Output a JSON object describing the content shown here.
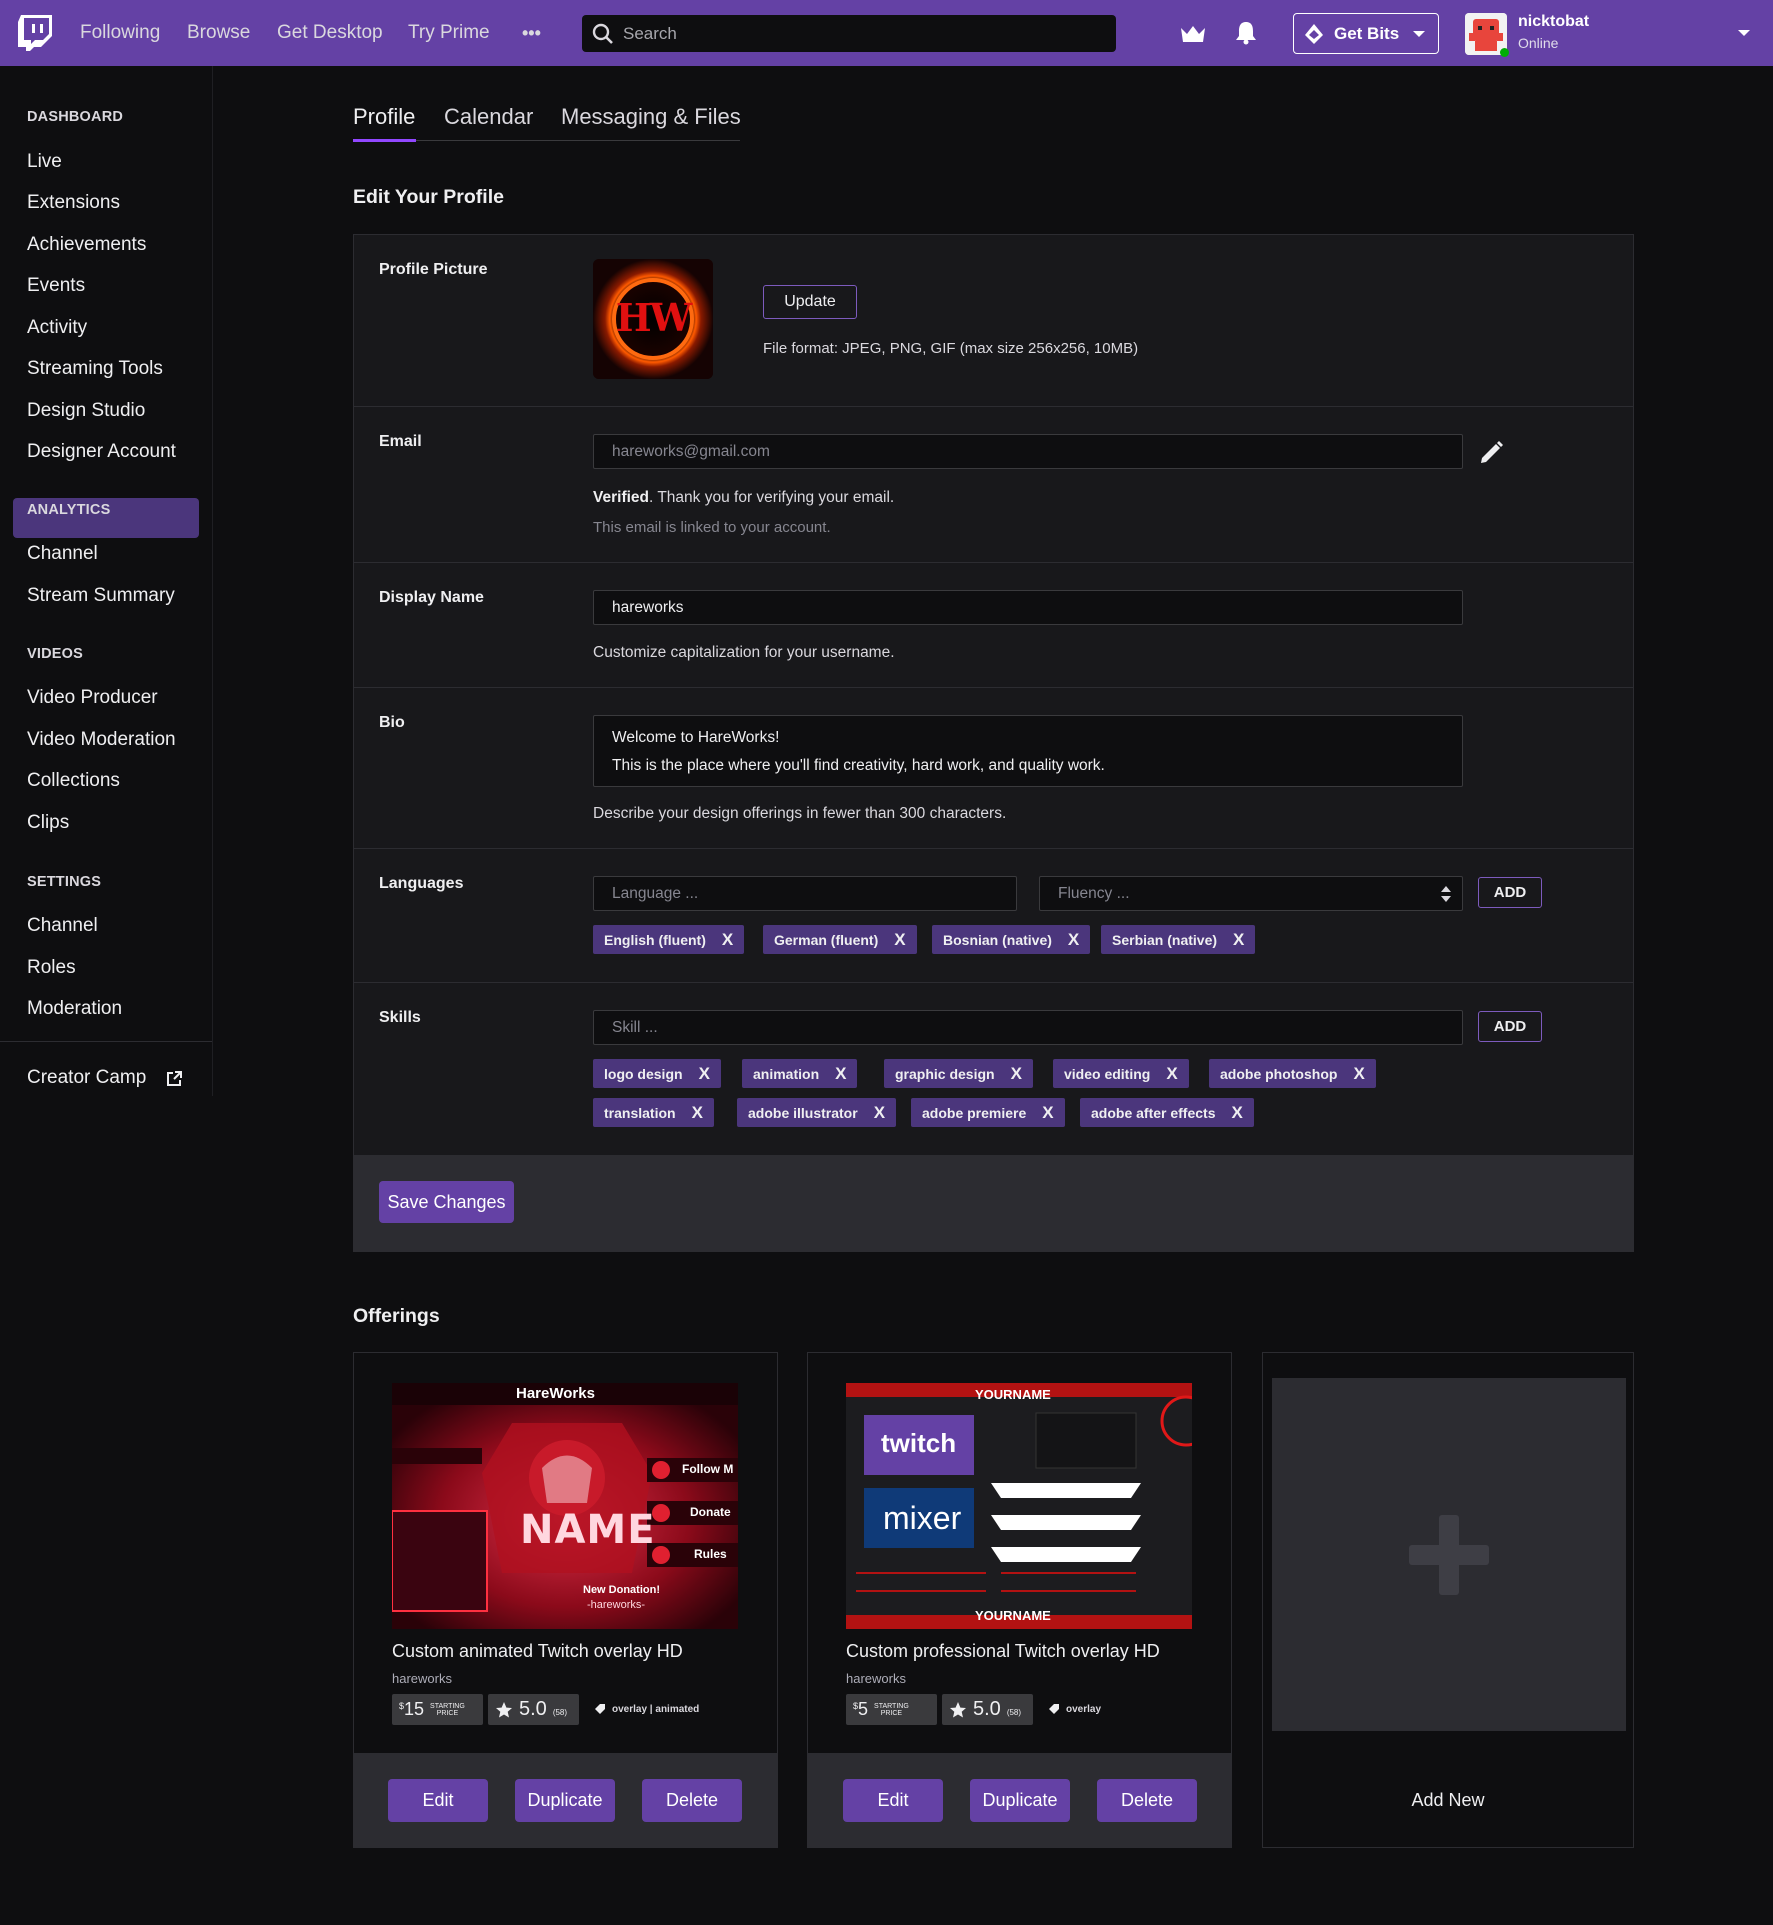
{
  "topbar": {
    "nav": [
      "Following",
      "Browse",
      "Get Desktop",
      "Try Prime"
    ],
    "more": "•••",
    "search_placeholder": "Search",
    "get_bits": "Get Bits",
    "user_name": "nicktobat",
    "user_status": "Online"
  },
  "sidebar": {
    "dashboard_head": "DASHBOARD",
    "dashboard_items": [
      "Live",
      "Extensions",
      "Achievements",
      "Events",
      "Activity",
      "Streaming Tools",
      "Design Studio",
      "Designer Account"
    ],
    "analytics_head": "ANALYTICS",
    "analytics_items": [
      "Channel",
      "Stream Summary"
    ],
    "videos_head": "VIDEOS",
    "videos_items": [
      "Video Producer",
      "Video Moderation",
      "Collections",
      "Clips"
    ],
    "settings_head": "SETTINGS",
    "settings_items": [
      "Channel",
      "Roles",
      "Moderation"
    ],
    "creator_camp": "Creator Camp"
  },
  "tabs": [
    "Profile",
    "Calendar",
    "Messaging & Files"
  ],
  "profile": {
    "heading": "Edit Your Profile",
    "picture_label": "Profile Picture",
    "picture_initials": "HW",
    "update_button": "Update",
    "file_format": "File format: JPEG, PNG, GIF (max size 256x256, 10MB)",
    "email_label": "Email",
    "email_value": "hareworks@gmail.com",
    "verified_bold": "Verified",
    "verified_text": ". Thank you for verifying your email.",
    "email_linked": "This email is linked to your account.",
    "display_label": "Display Name",
    "display_value": "hareworks",
    "display_hint": "Customize capitalization for your username.",
    "bio_label": "Bio",
    "bio_line1": "Welcome to HareWorks!",
    "bio_line2": "This is the place where you'll find creativity, hard work, and quality work.",
    "bio_hint": "Describe your design offerings in fewer than 300 characters.",
    "languages_label": "Languages",
    "language_placeholder": "Language ...",
    "fluency_placeholder": "Fluency ...",
    "add_label": "ADD",
    "languages": [
      "English (fluent)",
      "German (fluent)",
      "Bosnian (native)",
      "Serbian (native)"
    ],
    "skills_label": "Skills",
    "skill_placeholder": "Skill ...",
    "skills": [
      "logo design",
      "animation",
      "graphic design",
      "video editing",
      "adobe photoshop",
      "translation",
      "adobe illustrator",
      "adobe premiere",
      "adobe after effects"
    ],
    "remove_glyph": "X",
    "save_button": "Save Changes"
  },
  "offerings": {
    "heading": "Offerings",
    "items": [
      {
        "title": "Custom animated Twitch overlay HD",
        "author": "hareworks",
        "price_symbol": "$",
        "price": "15",
        "price_caption_1": "STARTING",
        "price_caption_2": "PRICE",
        "rating": "5.0",
        "reviews": "(58)",
        "tags": "overlay | animated",
        "thumb_brand": "HareWorks",
        "thumb_name": "NAME",
        "thumb_follow": "Follow M",
        "thumb_donate": "Donate",
        "thumb_rules": "Rules",
        "thumb_donation": "New Donation!",
        "thumb_donation_name": "-hareworks-"
      },
      {
        "title": "Custom professional Twitch overlay HD",
        "author": "hareworks",
        "price_symbol": "$",
        "price": "5",
        "price_caption_1": "STARTING",
        "price_caption_2": "PRICE",
        "rating": "5.0",
        "reviews": "(58)",
        "tags": "overlay",
        "thumb_yourname": "YOURNAME",
        "thumb_twitch": "twitch",
        "thumb_mixer": "mixer"
      }
    ],
    "actions": [
      "Edit",
      "Duplicate",
      "Delete"
    ],
    "add_new": "Add New"
  },
  "colors": {
    "brand": "#6441a5",
    "chip": "#4b367c",
    "background": "#0e0e10",
    "card": "#18181b"
  }
}
